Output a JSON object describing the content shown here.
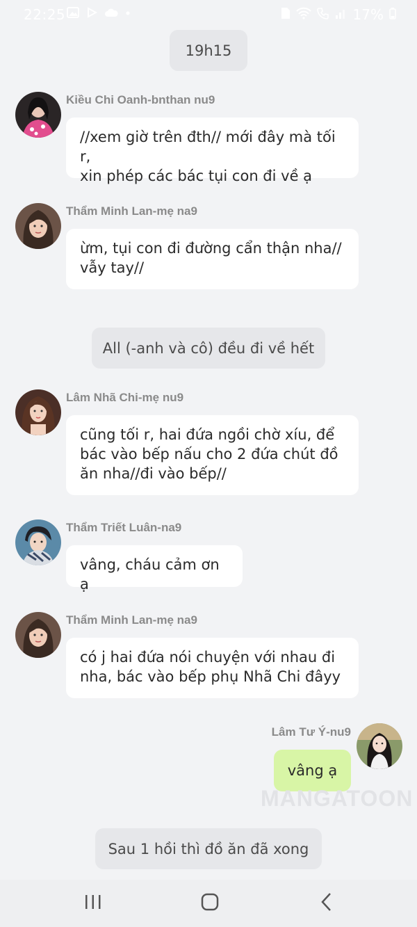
{
  "status_bar": {
    "time": "22:25",
    "battery": "17%",
    "icons": [
      "gallery-icon",
      "play-icon",
      "cloud-icon",
      "dot-icon",
      "sim-icon",
      "wifi-icon",
      "call-icon",
      "signal-icon",
      "battery-icon"
    ]
  },
  "chat": {
    "time_marker": "19h15",
    "messages": [
      {
        "name": "Kiều Chi Oanh-bnthan nu9",
        "text_lines": [
          "//xem giờ trên đth// mới đây mà tối r,",
          "xin phép các bác tụi con đi về ạ"
        ]
      },
      {
        "name": "Thẩm Minh Lan-mẹ na9",
        "text_lines": [
          "ừm, tụi con đi đường cẩn thận nha//",
          "vẫy tay//"
        ]
      },
      {
        "name": "Lâm Nhã Chi-mẹ nu9",
        "text_lines": [
          "cũng tối r, hai đứa ngồi chờ xíu, để",
          "bác vào bếp nấu cho 2 đứa chút đồ",
          "ăn nha//đi vào bếp//"
        ]
      },
      {
        "name": "Thẩm Triết Luân-na9",
        "text_lines": [
          "vâng, cháu cảm ơn ạ"
        ]
      },
      {
        "name": "Thẩm Minh Lan-mẹ na9",
        "text_lines": [
          "có j hai đứa nói chuyện với nhau đi",
          "nha, bác vào bếp phụ Nhã Chi đâyy"
        ]
      }
    ],
    "narration_1": "All (-anh và cô) đều đi về hết",
    "self_message": {
      "name": "Lâm Tư Ý-nu9",
      "text": "vâng ạ"
    },
    "narration_2": "Sau 1 hồi thì đồ ăn đã xong",
    "watermark": "MANGATOON"
  },
  "nav": {
    "icons": [
      "recent-apps-icon",
      "home-icon",
      "back-icon"
    ]
  },
  "colors": {
    "background": "#f2f3f5",
    "bubble_in": "#ffffff",
    "bubble_out": "#d8f5a6",
    "pill": "#e6e7ea"
  }
}
